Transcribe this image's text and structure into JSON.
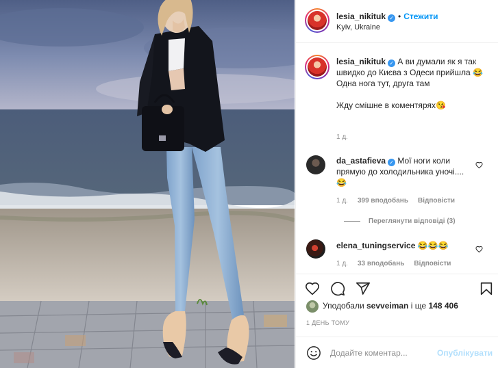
{
  "post": {
    "author": "lesia_nikituk",
    "follow_label": "Стежити",
    "separator": "•",
    "location": "Kyiv, Ukraine"
  },
  "caption": {
    "author": "lesia_nikituk",
    "line1": "А ви думали як я так швидко до Києва з Одеси прийшла",
    "line1_emoji": "😂",
    "line2": "Одна нога тут, друга там",
    "line3": "Жду смішне в коментярях",
    "line3_emoji": "😘",
    "time": "1 д."
  },
  "comments": [
    {
      "author": "da_astafieva",
      "text": "Мої ноги коли прямую до холодильника уночі....",
      "emoji": "😂",
      "time": "1 д.",
      "likes": "399 вподобань",
      "reply": "Відповісти",
      "verified": true
    },
    {
      "author": "elena_tuningservice",
      "text": "",
      "emoji": "😂😂😂",
      "time": "1 д.",
      "likes": "33 вподобань",
      "reply": "Відповісти",
      "verified": false
    }
  ],
  "view_replies": "Переглянути відповіді (3)",
  "likes_line": {
    "prefix": "Уподобали",
    "user": "sevveiman",
    "connector": "і ще",
    "count": "148 406"
  },
  "timestamp": "1 ДЕНЬ ТОМУ",
  "composer": {
    "placeholder": "Додайте коментар...",
    "publish_label": "Опублікувати"
  },
  "icons": {
    "verified": "✓",
    "like": "heart-icon",
    "comment": "comment-icon",
    "share": "share-icon",
    "save": "bookmark-icon",
    "emoji": "emoji-icon"
  },
  "colors": {
    "accent": "#0095f6",
    "verified": "#3897f0",
    "muted": "#8e8e8e",
    "publish_disabled": "#b2dffc"
  }
}
